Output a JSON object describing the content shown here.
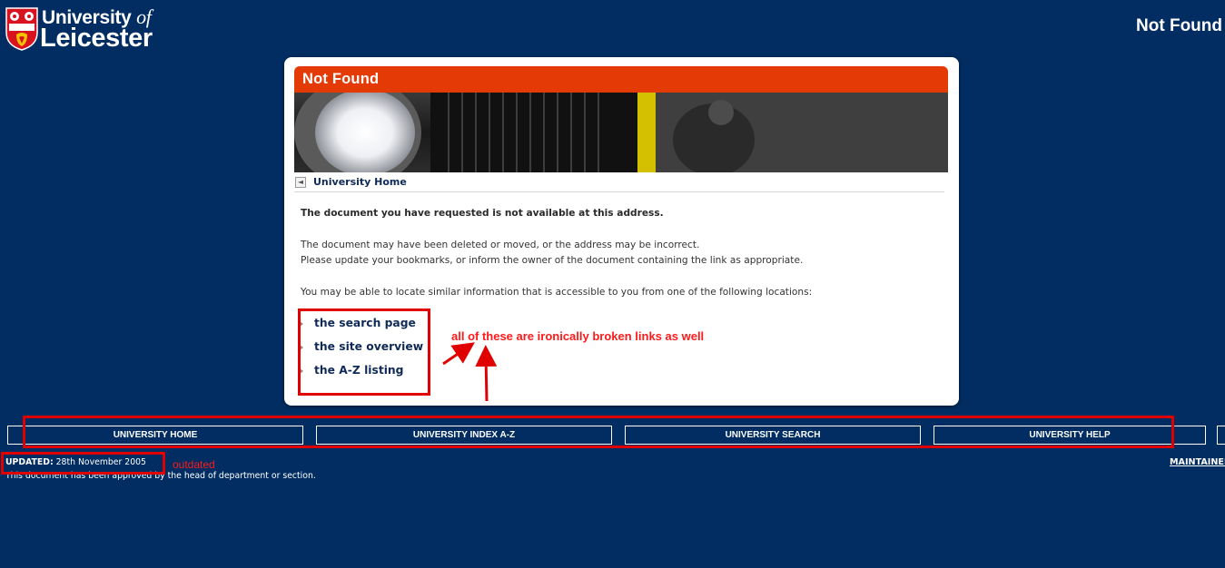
{
  "header": {
    "logo_line1": "University ",
    "logo_line1_italic": "of",
    "logo_line2": "Leicester",
    "page_title": "Not Found"
  },
  "card": {
    "title": "Not Found",
    "home_link": "University Home",
    "message_heading": "The document you have requested is not available at this address.",
    "message_line1": "The document may have been deleted or moved, or the address may be incorrect.",
    "message_line2": "Please update your bookmarks, or inform the owner of the document containing the link as appropriate.",
    "message_line3": "You may be able to locate similar information that is accessible to you from one of the following locations:",
    "links": [
      "the search page",
      "the site overview",
      "the A-Z listing"
    ]
  },
  "nav": [
    "UNIVERSITY HOME",
    "UNIVERSITY INDEX A-Z",
    "UNIVERSITY SEARCH",
    "UNIVERSITY HELP"
  ],
  "footer": {
    "updated_label": "UPDATED:",
    "updated_date": " 28th November 2005",
    "approved": "This document has been approved by the head of department or section.",
    "maintained": "MAINTAINED"
  },
  "annotations": {
    "broken_links_note": "all of these are ironically broken links as well",
    "outdated_note": "outdated"
  },
  "colors": {
    "background": "#012d62",
    "header_bar": "#e33a06",
    "annotation_red": "#e00000",
    "link_text": "#0f2a58"
  }
}
